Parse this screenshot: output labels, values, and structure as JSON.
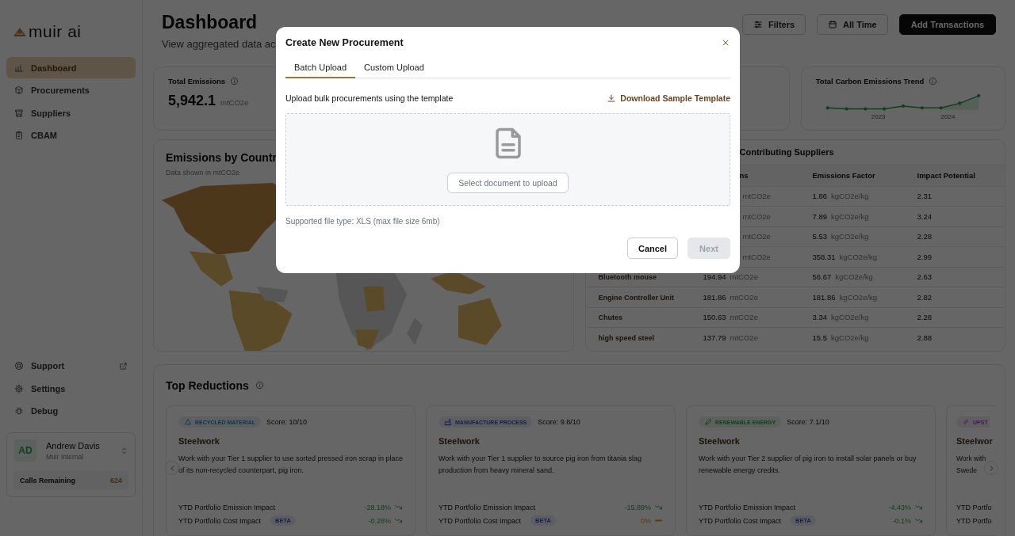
{
  "sidebar": {
    "logo": "muir ai",
    "nav": [
      {
        "label": "Dashboard",
        "selected": true
      },
      {
        "label": "Procurements",
        "selected": false
      },
      {
        "label": "Suppliers",
        "selected": false
      },
      {
        "label": "CBAM",
        "selected": false
      }
    ],
    "footer_nav": [
      {
        "label": "Support",
        "external": true
      },
      {
        "label": "Settings",
        "external": false
      },
      {
        "label": "Debug",
        "external": false
      }
    ],
    "user": {
      "initials": "AD",
      "name": "Andrew Davis",
      "org": "Muir Internal"
    },
    "calls": {
      "label": "Calls Remaining",
      "value": "624"
    }
  },
  "header": {
    "title": "Dashboard",
    "subtitle": "View aggregated data ac",
    "buttons": [
      {
        "label": "Filters",
        "kind": "filter"
      },
      {
        "label": "All Time",
        "kind": "calendar"
      },
      {
        "label": "Add Transactions",
        "kind": "primary"
      }
    ]
  },
  "stats": [
    {
      "kind": "figure",
      "label": "Total Emissions",
      "value": "5,942.1",
      "unit": "mtCO2e"
    },
    {
      "kind": "blank"
    },
    {
      "kind": "trend",
      "label": "Total Carbon Emissions Trend",
      "x_labels": [
        "2023",
        "2024"
      ]
    }
  ],
  "map": {
    "title": "Emissions by Countr",
    "subtitle": "Data shown in mtCO2e"
  },
  "suppliers": {
    "title": "Contributing Suppliers",
    "columns": [
      "ns",
      "Emissions Factor",
      "Impact Potential"
    ],
    "rows": [
      {
        "emissions_unit": "mtCO2e",
        "factor": "1.86",
        "factor_unit": "kgCO2e/kg",
        "impact": "2.31"
      },
      {
        "emissions_unit": "mtCO2e",
        "factor": "7.89",
        "factor_unit": "kgCO2e/kg",
        "impact": "3.24"
      },
      {
        "emissions_unit": "mtCO2e",
        "factor": "5.53",
        "factor_unit": "kgCO2e/kg",
        "impact": "2.28"
      },
      {
        "emissions_unit": "mtCO2e",
        "factor": "358.31",
        "factor_unit": "kgCO2e/kg",
        "impact": "2.99"
      },
      {
        "name": "Bluetooth mouse",
        "emissions": "194.94",
        "emissions_unit": "mtCO2e",
        "factor": "56.67",
        "factor_unit": "kgCO2e/kg",
        "impact": "2.63"
      },
      {
        "name": "Engine Controller Unit",
        "emissions": "181.86",
        "emissions_unit": "mtCO2e",
        "factor": "181.86",
        "factor_unit": "kgCO2e/kg",
        "impact": "2.82"
      },
      {
        "name": "Chutes",
        "emissions": "150.63",
        "emissions_unit": "mtCO2e",
        "factor": "3.34",
        "factor_unit": "kgCO2e/kg",
        "impact": "2.28"
      },
      {
        "name": "high speed steel",
        "emissions": "137.79",
        "emissions_unit": "mtCO2e",
        "factor": "15.5",
        "factor_unit": "kgCO2e/kg",
        "impact": "2.88"
      }
    ]
  },
  "reductions": {
    "title": "Top Reductions",
    "cards": [
      {
        "kind": "recycled",
        "tag": "RECYCLED MATERIAL",
        "score": "Score: 10/10",
        "title": "Steelwork",
        "description": "Work with your Tier 1 supplier to use sorted pressed iron scrap in place of its non-recycled counterpart, pig iron.",
        "metrics": [
          {
            "label": "YTD Portfolio Emission Impact",
            "value": "-28.18%",
            "kind": "down"
          },
          {
            "label": "YTD Portfolio Cost Impact",
            "badge": "BETA",
            "value": "-0.28%",
            "kind": "down"
          }
        ]
      },
      {
        "kind": "manufacture",
        "tag": "MANUFACTURE PROCESS",
        "score": "Score: 9.8/10",
        "title": "Steelwork",
        "description": "Work with your Tier 1 supplier to source pig iron from titania slag production from heavy mineral sand.",
        "metrics": [
          {
            "label": "YTD Portfolio Emission Impact",
            "value": "-15.89%",
            "kind": "down"
          },
          {
            "label": "YTD Portfolio Cost Impact",
            "badge": "BETA",
            "value": "0%",
            "kind": "flat"
          }
        ]
      },
      {
        "kind": "renewable",
        "tag": "RENEWABLE ENERGY",
        "score": "Score: 7.1/10",
        "title": "Steelwork",
        "description": "Work with your Tier 2 supplier of pig iron to install solar panels or buy renewable energy credits.",
        "metrics": [
          {
            "label": "YTD Portfolio Emission Impact",
            "value": "-4.43%",
            "kind": "down"
          },
          {
            "label": "YTD Portfolio Cost Impact",
            "badge": "BETA",
            "value": "-0.1%",
            "kind": "down"
          }
        ]
      },
      {
        "kind": "upstream",
        "tag": "UPST",
        "title": "Steelwor",
        "description": "Work with Swede",
        "metrics": [
          {
            "label": "YTD Portfo"
          },
          {
            "label": "YTD Portfo"
          }
        ]
      }
    ]
  },
  "modal": {
    "title": "Create New Procurement",
    "tabs": [
      {
        "label": "Batch Upload",
        "selected": true
      },
      {
        "label": "Custom Upload",
        "selected": false
      }
    ],
    "description": "Upload bulk procurements using the template",
    "download_link": "Download Sample Template",
    "upload_button": "Select document to upload",
    "note": "Supported file type: XLS (max file size 6mb)",
    "buttons": [
      {
        "label": "Cancel",
        "kind": "secondary",
        "disabled": false
      },
      {
        "label": "Next",
        "kind": "primary",
        "disabled": true
      }
    ]
  }
}
